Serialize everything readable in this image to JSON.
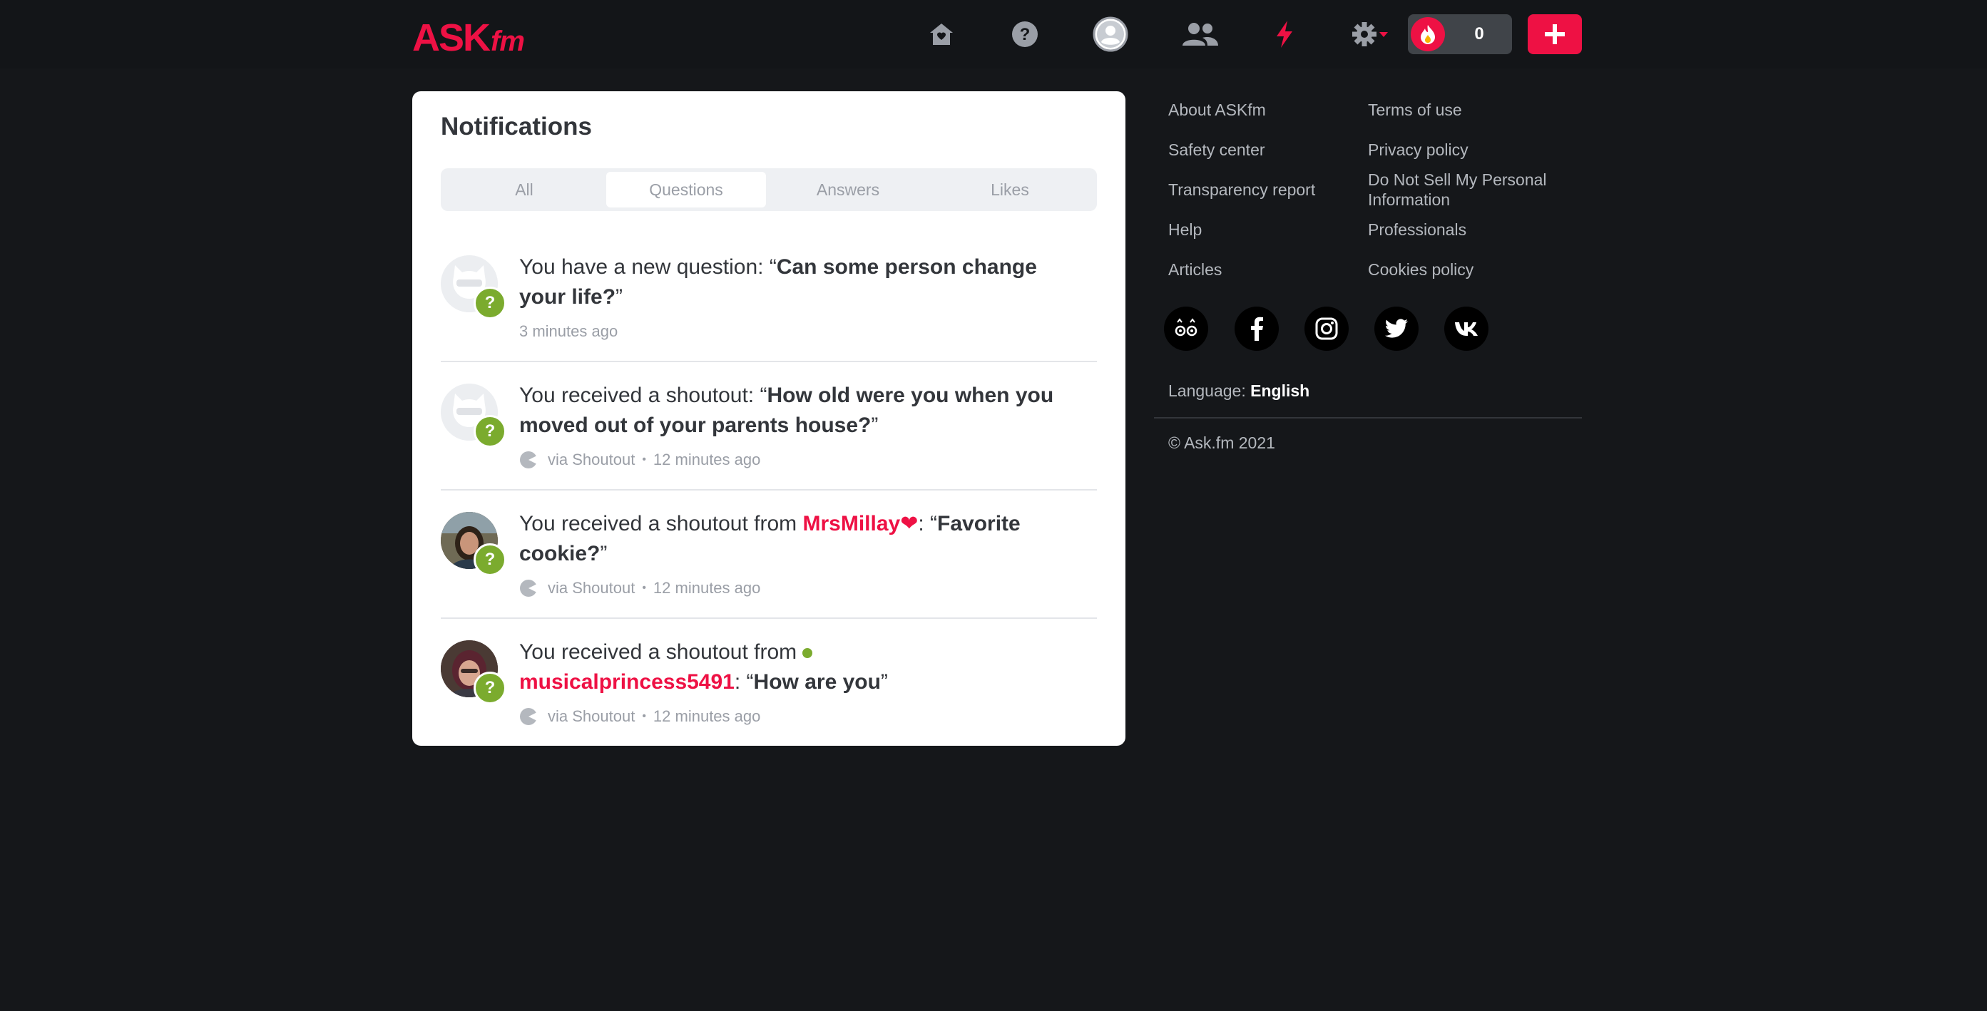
{
  "header": {
    "logo_main": "ASK",
    "logo_suffix": "fm",
    "nav_icons": [
      "home-icon",
      "question-icon",
      "profile-icon",
      "friends-icon",
      "lightning-icon",
      "gear-icon"
    ],
    "points_count": "0"
  },
  "notifications": {
    "title": "Notifications",
    "tabs": [
      {
        "label": "All",
        "active": false
      },
      {
        "label": "Questions",
        "active": true
      },
      {
        "label": "Answers",
        "active": false
      },
      {
        "label": "Likes",
        "active": false
      }
    ],
    "items": [
      {
        "prefix": "You have a new question: “",
        "question": "Can some person change your life?",
        "suffix": "”",
        "time": "3 minutes ago"
      },
      {
        "prefix": "You received a shoutout: “",
        "question": "How old were you when you moved out of your parents house?",
        "suffix": "”",
        "via": "via Shoutout",
        "time": "12 minutes ago"
      },
      {
        "prefix": "You received a shoutout from ",
        "user": "MrsMillay",
        "user_suffix": "❤",
        "mid": ": “",
        "question": "Favorite cookie?",
        "suffix": "”",
        "via": "via Shoutout",
        "time": "12 minutes ago"
      },
      {
        "prefix": "You received a shoutout from",
        "user": "musicalprincess5491",
        "mid": ": “",
        "question": "How are you",
        "suffix": "”",
        "via": "via Shoutout",
        "time": "12 minutes ago"
      }
    ]
  },
  "sidebar": {
    "links_left": [
      "About ASKfm",
      "Safety center",
      "Transparency report",
      "Help",
      "Articles"
    ],
    "links_right": [
      "Terms of use",
      "Privacy policy",
      "Do Not Sell My Personal Information",
      "Professionals",
      "Cookies policy"
    ],
    "social_icons": [
      "askfm-icon",
      "facebook-icon",
      "instagram-icon",
      "twitter-icon",
      "vk-icon"
    ],
    "language_label": "Language: ",
    "language_value": "English",
    "copyright": "© Ask.fm 2021"
  },
  "colors": {
    "brand": "#ee1144",
    "background": "#15171a",
    "badge_green": "#7bab2e"
  }
}
